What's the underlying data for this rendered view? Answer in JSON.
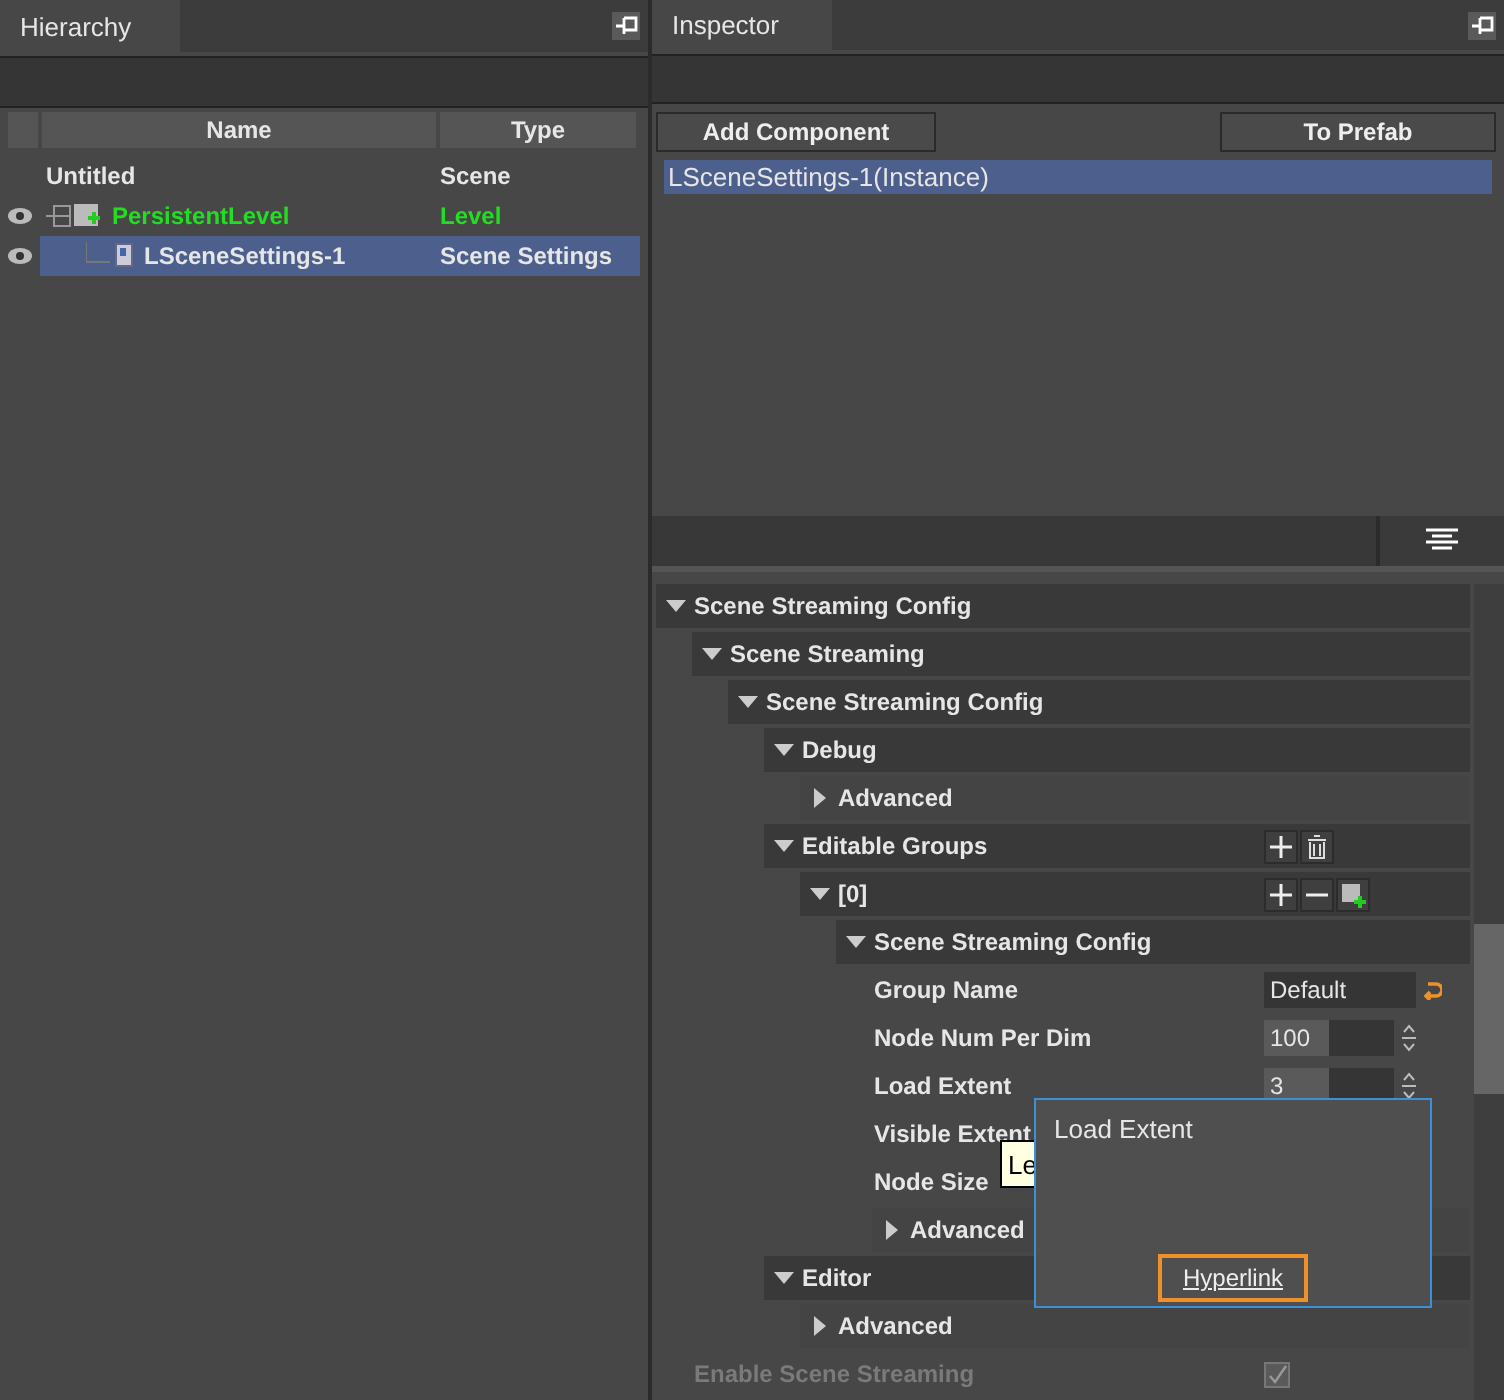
{
  "hierarchy": {
    "title": "Hierarchy",
    "columns": [
      "Name",
      "Type"
    ],
    "rows": [
      {
        "name": "Untitled",
        "type": "Scene",
        "visible": false,
        "selected": false,
        "children": [
          {
            "name": "PersistentLevel",
            "type": "Level",
            "kind": "level",
            "visible": true,
            "selected": false,
            "children": [
              {
                "name": "LSceneSettings-1",
                "type": "Scene Settings",
                "kind": "settings",
                "visible": true,
                "selected": true
              }
            ]
          }
        ]
      }
    ]
  },
  "inspector": {
    "title": "Inspector",
    "buttons": [
      "Add Component",
      "To Prefab"
    ],
    "instances": [
      {
        "label": "LSceneSettings-1(Instance)",
        "selected": true
      }
    ],
    "tree": [
      {
        "kind": "group",
        "label": "Scene Streaming Config",
        "expanded": true,
        "children": [
          {
            "kind": "group",
            "label": "Scene Streaming",
            "expanded": true,
            "children": [
              {
                "kind": "group",
                "label": "Scene Streaming Config",
                "expanded": true,
                "children": [
                  {
                    "kind": "group",
                    "label": "Debug",
                    "expanded": true,
                    "children": [
                      {
                        "kind": "group",
                        "label": "Advanced",
                        "expanded": false
                      }
                    ]
                  },
                  {
                    "kind": "group",
                    "label": "Editable Groups",
                    "expanded": true,
                    "actions": [
                      {
                        "kind": "add"
                      },
                      {
                        "kind": "delete"
                      }
                    ],
                    "children": [
                      {
                        "kind": "group",
                        "label": "[0]",
                        "expanded": true,
                        "actions": [
                          {
                            "kind": "add"
                          },
                          {
                            "kind": "remove"
                          },
                          {
                            "kind": "add-layer"
                          }
                        ],
                        "children": [
                          {
                            "kind": "group",
                            "label": "Scene Streaming Config",
                            "expanded": true,
                            "children": [
                              {
                                "kind": "text",
                                "label": "Group Name",
                                "value": "Default",
                                "modified": true
                              },
                              {
                                "kind": "spin",
                                "label": "Node Num Per Dim",
                                "value": "100"
                              },
                              {
                                "kind": "spin",
                                "label": "Load Extent",
                                "value": "3"
                              },
                              {
                                "kind": "label",
                                "label": "Visible Extent"
                              },
                              {
                                "kind": "label",
                                "label": "Node Size"
                              },
                              {
                                "kind": "group",
                                "label": "Advanced",
                                "expanded": false
                              }
                            ]
                          }
                        ]
                      }
                    ]
                  },
                  {
                    "kind": "group",
                    "label": "Editor",
                    "expanded": true,
                    "children": [
                      {
                        "kind": "group",
                        "label": "Advanced",
                        "expanded": false
                      }
                    ]
                  }
                ]
              }
            ]
          }
        ]
      },
      {
        "kind": "checkbox",
        "label": "Enable Scene Streaming",
        "checked": true,
        "disabled": true
      }
    ],
    "tooltip": "Le",
    "popup": {
      "title": "Load Extent",
      "link": "Hyperlink"
    }
  }
}
